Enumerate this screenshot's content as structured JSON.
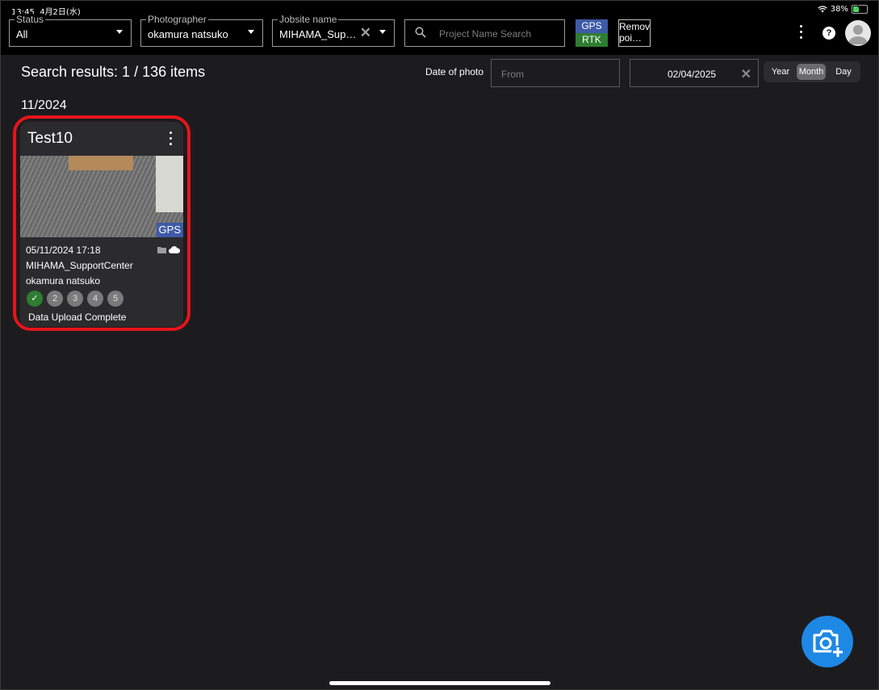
{
  "status_bar": {
    "time": "13:45",
    "date": "4月2日(水)",
    "battery": "38%"
  },
  "filters": {
    "status": {
      "label": "Status",
      "value": "All"
    },
    "photographer": {
      "label": "Photographer",
      "value": "okamura natsuko"
    },
    "jobsite": {
      "label": "Jobsite name",
      "value": "MIHAMA_Sup…"
    },
    "search": {
      "placeholder": "Project Name Search"
    },
    "gps_badge": {
      "gps": "GPS",
      "rtk": "RTK"
    },
    "remove_points": "Remove poi…"
  },
  "results": {
    "summary": "Search results: 1 / 136 items"
  },
  "date_filter": {
    "label": "Date of photo",
    "from_placeholder": "From",
    "to_value": "02/04/2025",
    "granularity": {
      "options": [
        "Year",
        "Month",
        "Day"
      ],
      "selected": "Month"
    }
  },
  "groups": [
    {
      "date": "11/2024",
      "cards": [
        {
          "title": "Test10",
          "gps_tag": "GPS",
          "datetime": "05/11/2024   17:18",
          "site": "MIHAMA_SupportCenter",
          "photographer": "okamura natsuko",
          "steps": [
            "✓",
            "2",
            "3",
            "4",
            "5"
          ],
          "status": "Data Upload Complete"
        }
      ]
    }
  ],
  "colors": {
    "accent_blue": "#1e88e5",
    "gps_blue": "#3e5aa8",
    "rtk_green": "#2e7d32",
    "highlight_red": "#e8141b"
  }
}
